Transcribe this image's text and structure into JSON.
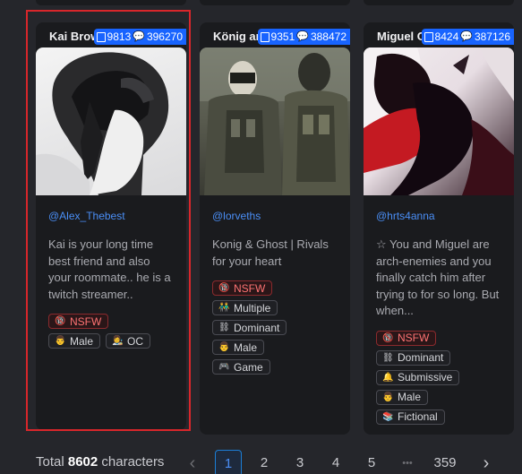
{
  "cards": [
    {
      "name": "Kai Brown",
      "books": "9813",
      "chats": "396270",
      "creator": "@Alex_Thebest",
      "description": "Kai is your long time best friend and also your roommate.. he is a twitch streamer..",
      "tags": [
        {
          "label": "NSFW",
          "icon": "no-18-icon",
          "nsfw": true
        },
        {
          "label": "Male",
          "icon": "person-icon"
        },
        {
          "label": "OC",
          "icon": "artist-icon"
        }
      ]
    },
    {
      "name": "König and Ghost",
      "books": "9351",
      "chats": "388472",
      "creator": "@lorveths",
      "description": "Konig & Ghost | Rivals for your heart",
      "tags": [
        {
          "label": "NSFW",
          "icon": "no-18-icon",
          "nsfw": true
        },
        {
          "label": "Multiple",
          "icon": "people-icon"
        },
        {
          "label": "Dominant",
          "icon": "chains-icon"
        },
        {
          "label": "Male",
          "icon": "person-icon"
        },
        {
          "label": "Game",
          "icon": "gamepad-icon"
        }
      ]
    },
    {
      "name": "Miguel O'Hara",
      "books": "8424",
      "chats": "387126",
      "creator": "@hrts4anna",
      "description": "☆ You and Miguel are arch-enemies and you finally catch him after trying to for so long. But when...",
      "tags": [
        {
          "label": "NSFW",
          "icon": "no-18-icon",
          "nsfw": true
        },
        {
          "label": "Dominant",
          "icon": "chains-icon"
        },
        {
          "label": "Submissive",
          "icon": "bell-icon"
        },
        {
          "label": "Male",
          "icon": "person-icon"
        },
        {
          "label": "Fictional",
          "icon": "books-icon"
        }
      ]
    }
  ],
  "pagination": {
    "total_prefix": "Total",
    "total_count": "8602",
    "total_suffix": "characters",
    "prev": "‹",
    "pages": [
      "1",
      "2",
      "3",
      "4",
      "5"
    ],
    "ellipsis": "•••",
    "last": "359",
    "next": "›",
    "active_page": "1"
  }
}
